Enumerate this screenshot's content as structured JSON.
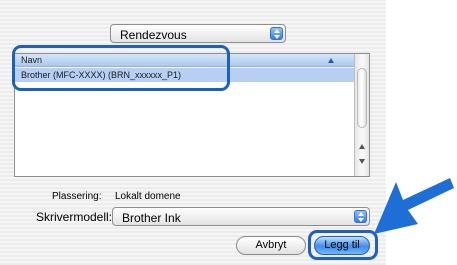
{
  "service_popup": {
    "selected": "Rendezvous"
  },
  "printer_list": {
    "column_header": "Navn",
    "rows": [
      {
        "name": "Brother (MFC-XXXX) (BRN_xxxxxx_P1)"
      }
    ]
  },
  "location": {
    "label": "Plassering:",
    "value": "Lokalt domene"
  },
  "printer_model": {
    "label": "Skrivermodell:",
    "selected": "Brother Ink"
  },
  "buttons": {
    "cancel": "Avbryt",
    "add": "Legg til"
  },
  "annotation": {
    "highlight_color": "#1e5fc4",
    "arrow_color": "#1e6ed8"
  }
}
